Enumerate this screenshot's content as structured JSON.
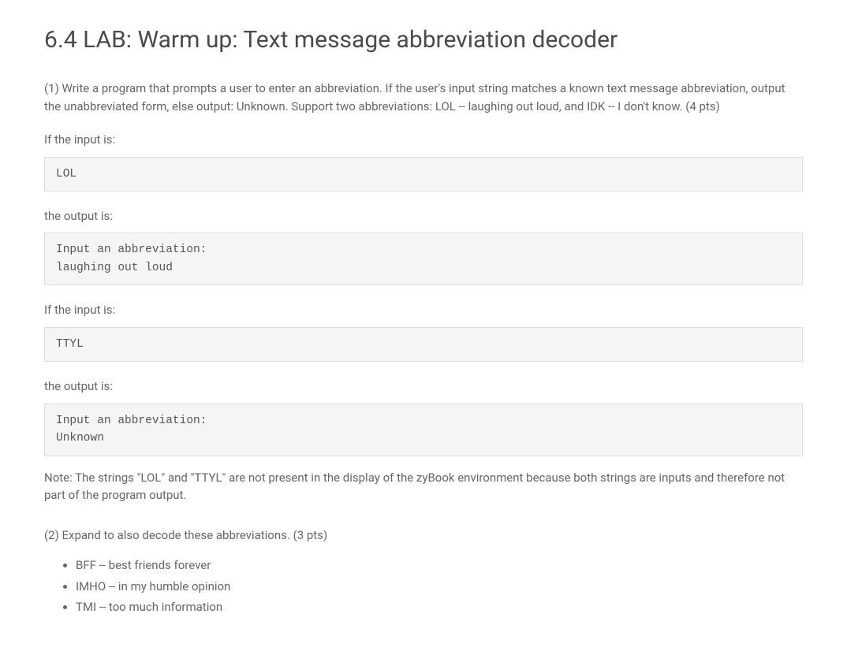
{
  "title": "6.4 LAB: Warm up: Text message abbreviation decoder",
  "intro": "(1) Write a program that prompts a user to enter an abbreviation. If the user's input string matches a known text message abbreviation, output the unabbreviated form, else output: Unknown. Support two abbreviations: LOL -- laughing out loud, and IDK -- I don't know. (4 pts)",
  "if_input_1": "If the input is:",
  "code_input_1": "LOL",
  "output_label_1": "the output is:",
  "code_output_1": "Input an abbreviation:\nlaughing out loud",
  "if_input_2": "If the input is:",
  "code_input_2": "TTYL",
  "output_label_2": "the output is:",
  "code_output_2": "Input an abbreviation:\nUnknown",
  "note": "Note: The strings \"LOL\" and \"TTYL\" are not present in the display of the zyBook environment because both strings are inputs and therefore not part of the program output.",
  "part2_intro": "(2) Expand to also decode these abbreviations. (3 pts)",
  "bullets": [
    "BFF -- best friends forever",
    "IMHO -- in my humble opinion",
    "TMI -- too much information"
  ]
}
